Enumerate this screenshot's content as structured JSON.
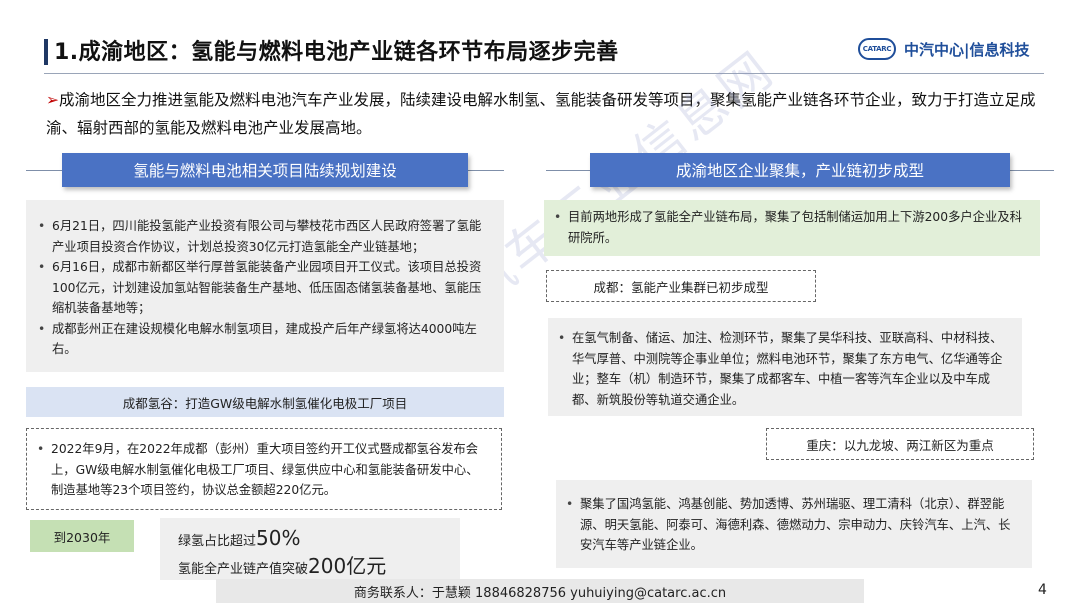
{
  "header": {
    "title": "1.成渝地区：氢能与燃料电池产业链各环节布局逐步完善",
    "logo_mark": "CATARC",
    "logo_text": "中汽中心|信息科技"
  },
  "intro": {
    "arrow": "➢",
    "text": "成渝地区全力推进氢能及燃料电池汽车产业发展，陆续建设电解水制氢、氢能装备研发等项目，聚集氢能产业链各环节企业，致力于打造立足成渝、辐射西部的氢能及燃料电池产业发展高地。"
  },
  "left": {
    "section_title": "氢能与燃料电池相关项目陆续规划建设",
    "projects": [
      "6月21日，四川能投氢能产业投资有限公司与攀枝花市西区人民政府签署了氢能产业项目投资合作协议，计划总投资30亿元打造氢能全产业链基地；",
      "6月16日，成都市新都区举行厚普氢能装备产业园项目开工仪式。该项目总投资100亿元，计划建设加氢站智能装备生产基地、低压固态储氢装备基地、氢能压缩机装备基地等；",
      "成都彭州正在建设规模化电解水制氢项目，建成投产后年产绿氢将达4000吨左右。"
    ],
    "valley_label": "成都氢谷：打造GW级电解水制氢催化电极工厂项目",
    "valley_items": [
      "2022年9月，在2022年成都（彭州）重大项目签约开工仪式暨成都氢谷发布会上，GW级电解水制氢催化电极工厂项目、绿氢供应中心和氢能装备研发中心、制造基地等23个项目签约，协议总金额超220亿元。"
    ],
    "target_label": "到2030年",
    "target_line1_prefix": "绿氢占比超过",
    "target_line1_value": "50%",
    "target_line2_prefix": "氢能全产业链产值突破",
    "target_line2_value": "200亿元"
  },
  "right": {
    "section_title": "成渝地区企业聚集，产业链初步成型",
    "summary": [
      "目前两地形成了氢能全产业链布局，聚集了包括制储运加用上下游200多户企业及科研院所。"
    ],
    "chengdu_label": "成都：氢能产业集群已初步成型",
    "chengdu_items": [
      "在氢气制备、储运、加注、检测环节，聚集了昊华科技、亚联高科、中材科技、华气厚普、中测院等企事业单位；燃料电池环节，聚集了东方电气、亿华通等企业；整车（机）制造环节，聚集了成都客车、中植一客等汽车企业以及中车成都、新筑股份等轨道交通企业。"
    ],
    "chongqing_label": "重庆：以九龙坡、两江新区为重点",
    "chongqing_items": [
      "聚集了国鸿氢能、鸿基创能、势加透博、苏州瑞驱、理工清科（北京）、群翌能源、明天氢能、阿泰可、海德利森、德燃动力、宗申动力、庆铃汽车、上汽、长安汽车等产业链企业。"
    ]
  },
  "watermark": "中国汽车工业信息网",
  "footer": {
    "contact": "商务联系人：于慧颖   18846828756   yuhuiying@catarc.ac.cn",
    "page_number": "4"
  },
  "colors": {
    "section_header": "#4a72c4",
    "summary_box": "#e2efd9",
    "valley_box": "#dae3f3",
    "target_box": "#c5e0b4",
    "accent_arrow": "#c00000",
    "title_bar": "#1f3864"
  }
}
